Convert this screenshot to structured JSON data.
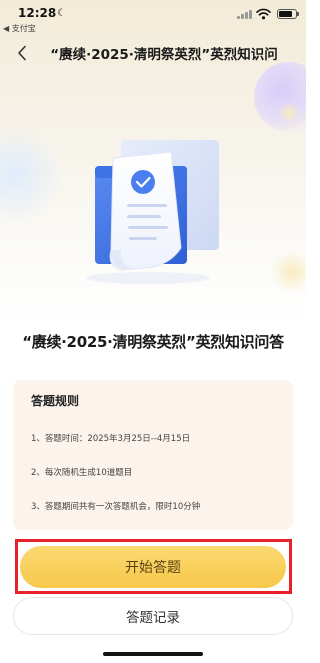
{
  "status_bar": {
    "time": "12:28",
    "back_app": "◀ 支付宝",
    "icons": [
      "moon-icon",
      "signal-icon",
      "wifi-icon",
      "battery-icon"
    ]
  },
  "nav": {
    "back_icon": "chevron-left-icon",
    "title": "“赓续·2025·清明祭英烈”英烈知识问"
  },
  "illustration": {
    "icon": "document-check-icon"
  },
  "quiz_title": "“赓续·2025·清明祭英烈”英烈知识问答",
  "rules": {
    "heading": "答题规则",
    "lines": [
      "1、答题时间：2025年3月25日--4月15日",
      "2、每次随机生成10道题目",
      "3、答题期间共有一次答题机会，限时10分钟"
    ]
  },
  "buttons": {
    "start": "开始答题",
    "record": "答题记录"
  },
  "colors": {
    "start_button": "#f7c84b",
    "highlight_border": "#e8202a",
    "rules_card_bg": "#fbf3ec",
    "illustration_blue": "#3d6fe0"
  }
}
